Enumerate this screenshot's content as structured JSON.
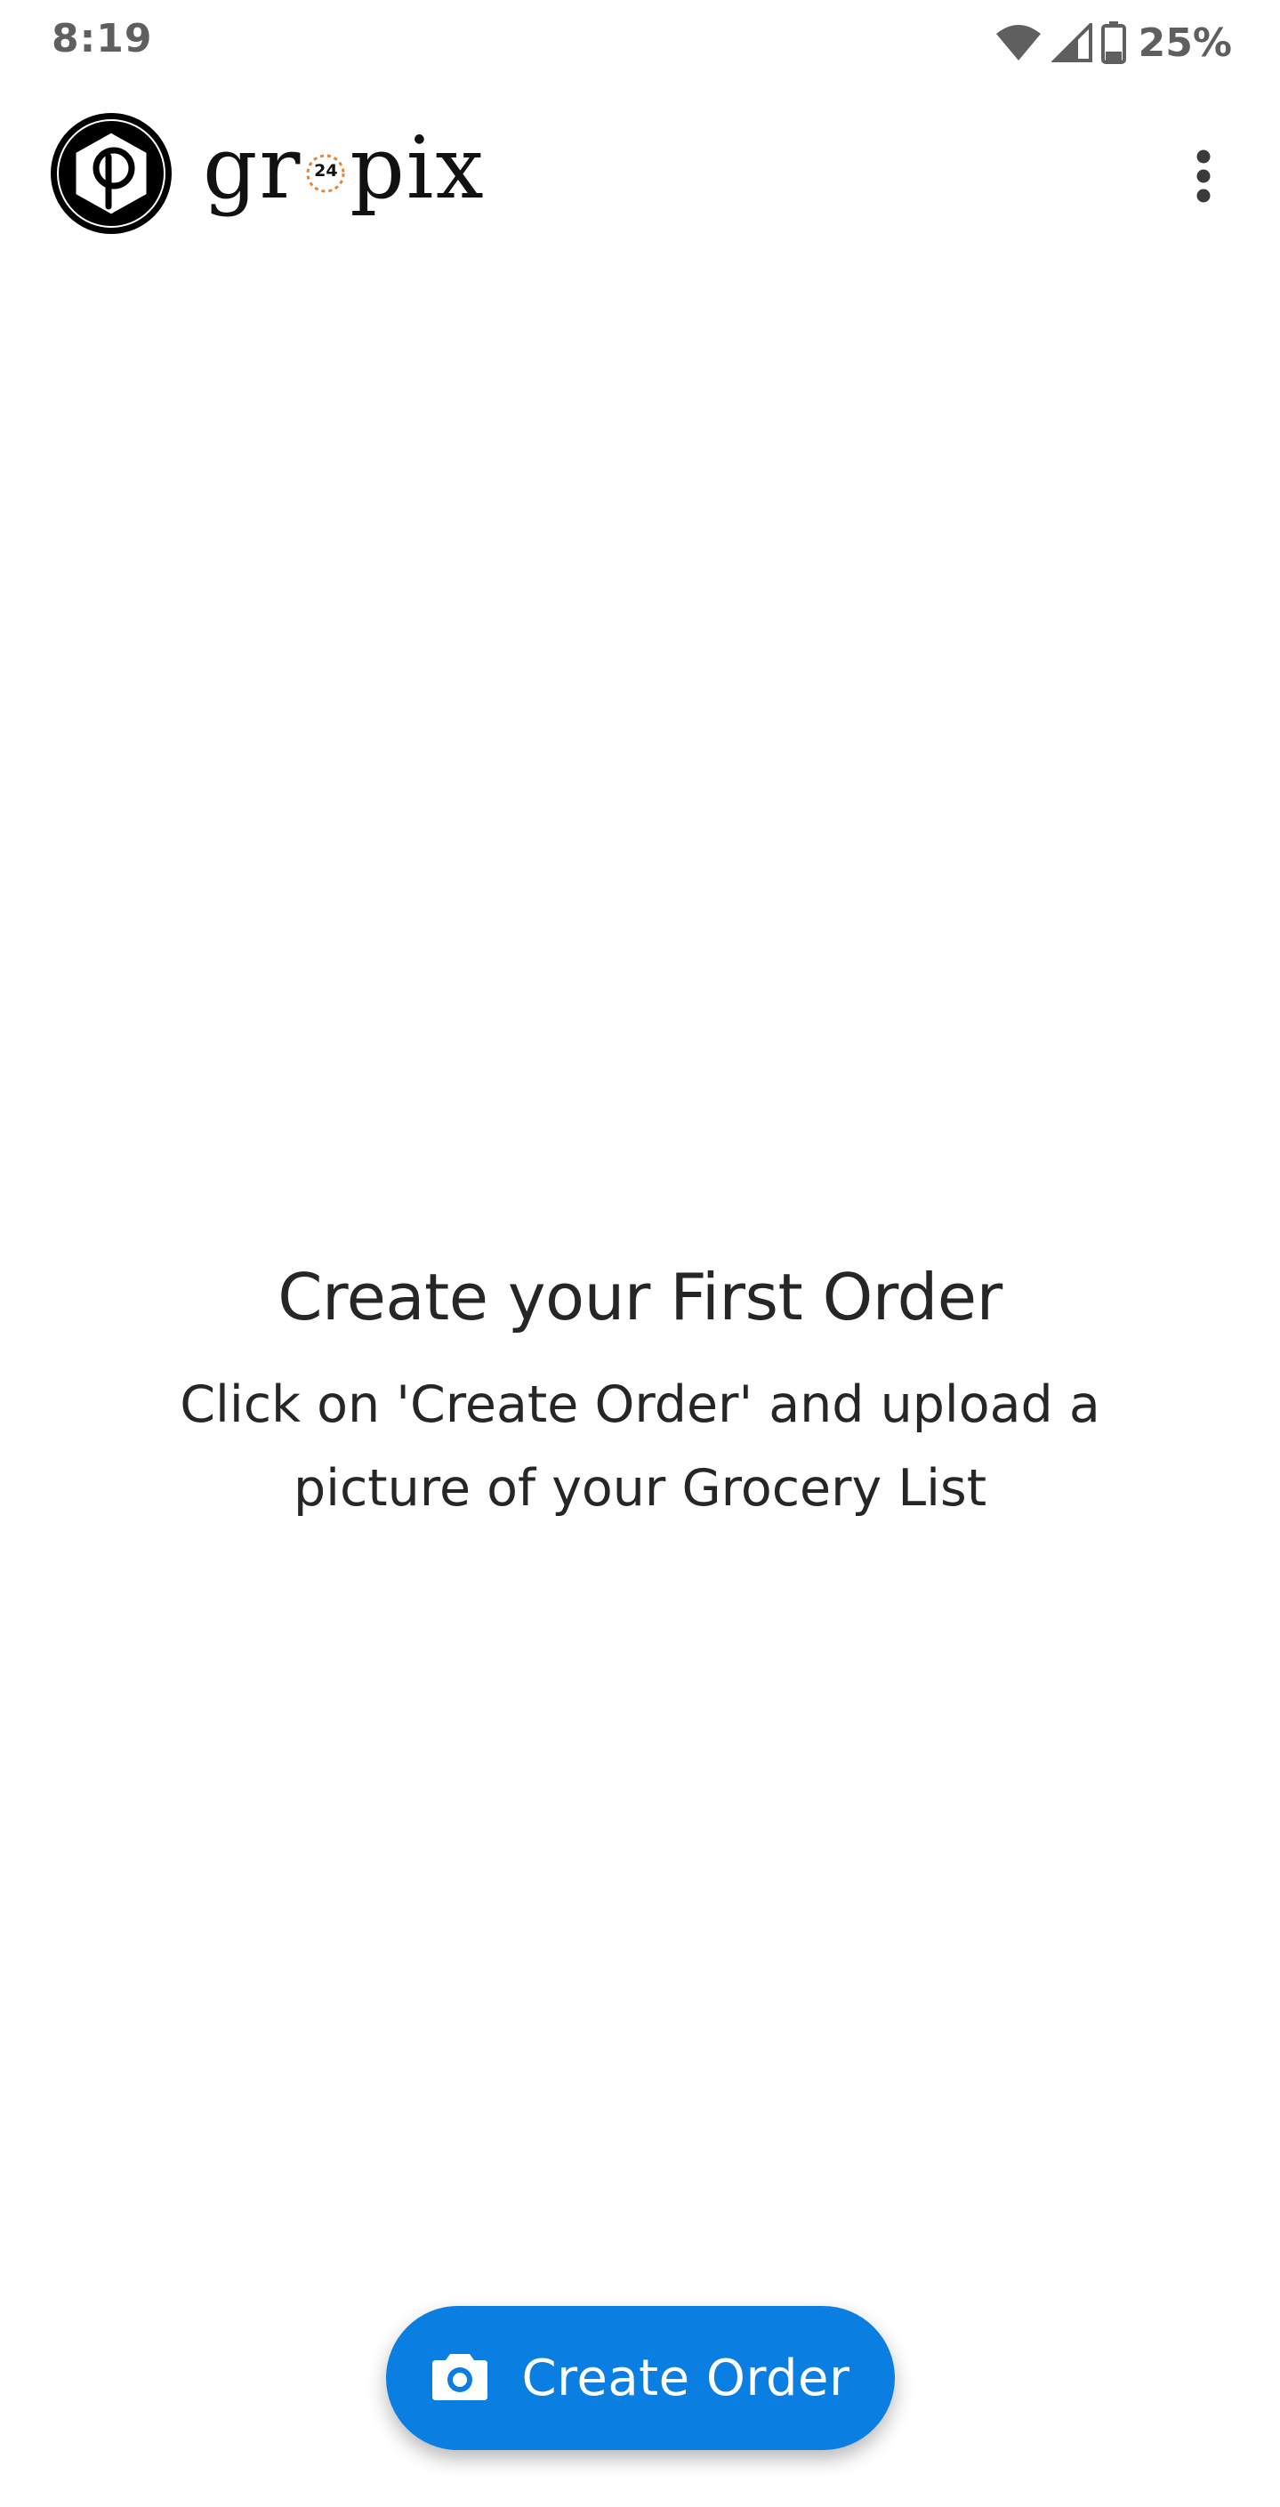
{
  "status_bar": {
    "time": "8:19",
    "battery_percent": "25%",
    "icons": [
      "wifi-icon",
      "cell-signal-icon",
      "battery-icon"
    ]
  },
  "app_bar": {
    "brand_before": "gr",
    "brand_badge": "24",
    "brand_after": "pix",
    "logo_icon": "aperture-logo-icon",
    "menu_icon": "more-vert-icon"
  },
  "empty_state": {
    "title": "Create your First Order",
    "subtitle": "Click on 'Create Order' and upload a picture of your Grocery List"
  },
  "fab": {
    "label": "Create Order",
    "icon": "camera-icon",
    "color": "#0a7fe1"
  },
  "colors": {
    "accent": "#0a7fe1",
    "badge": "#e8833a",
    "text": "#262626",
    "status_text": "#5f5f5f"
  }
}
